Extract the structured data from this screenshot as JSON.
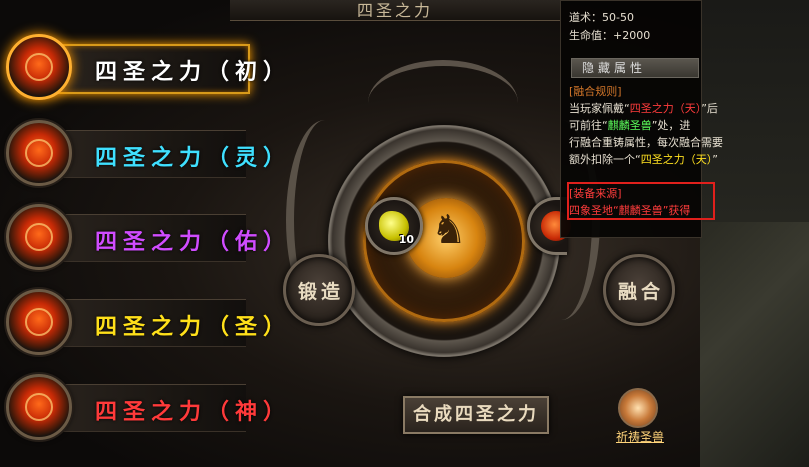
{
  "title": "四圣之力",
  "list": [
    {
      "label": "四圣之力（初）",
      "color": "#ffffff",
      "selected": true,
      "icon": "fire-dragon-orb-icon"
    },
    {
      "label": "四圣之力（灵）",
      "color": "#3fe0ff",
      "icon": "fire-orb-icon"
    },
    {
      "label": "四圣之力（佑）",
      "color": "#d04cff",
      "icon": "fire-orb-icon"
    },
    {
      "label": "四圣之力（圣）",
      "color": "#ffe01a",
      "icon": "fire-orb-icon"
    },
    {
      "label": "四圣之力（神）",
      "color": "#ff3a3a",
      "icon": "fire-orb-icon"
    }
  ],
  "slots": {
    "left": {
      "count": "10",
      "icon": "yellow-gem-icon"
    },
    "right": {
      "icon": "red-orb-icon"
    }
  },
  "buttons": {
    "forge": "锻造",
    "fuse": "融合",
    "craft": "合成四圣之力",
    "pray": "祈祷圣兽"
  },
  "tooltip": {
    "dao": "道术：50-50",
    "hp": "生命值：+2000",
    "hidden_attr": "隐藏属性",
    "rule_title": "[融合规则]",
    "rule_l1_a": "当玩家佩戴“",
    "rule_l1_b": "四圣之力（天）",
    "rule_l1_c": "”后",
    "rule_l2_a": "可前往“",
    "rule_l2_b": "麒麟圣兽",
    "rule_l2_c": "”处，进",
    "rule_l3": "行融合重铸属性，每次融合需要",
    "rule_l4_a": "额外扣除一个“",
    "rule_l4_b": "四圣之力（天）",
    "rule_l4_c": "”",
    "source_title": "[装备来源]",
    "source_text": "四象圣地“麒麟圣兽”获得"
  }
}
